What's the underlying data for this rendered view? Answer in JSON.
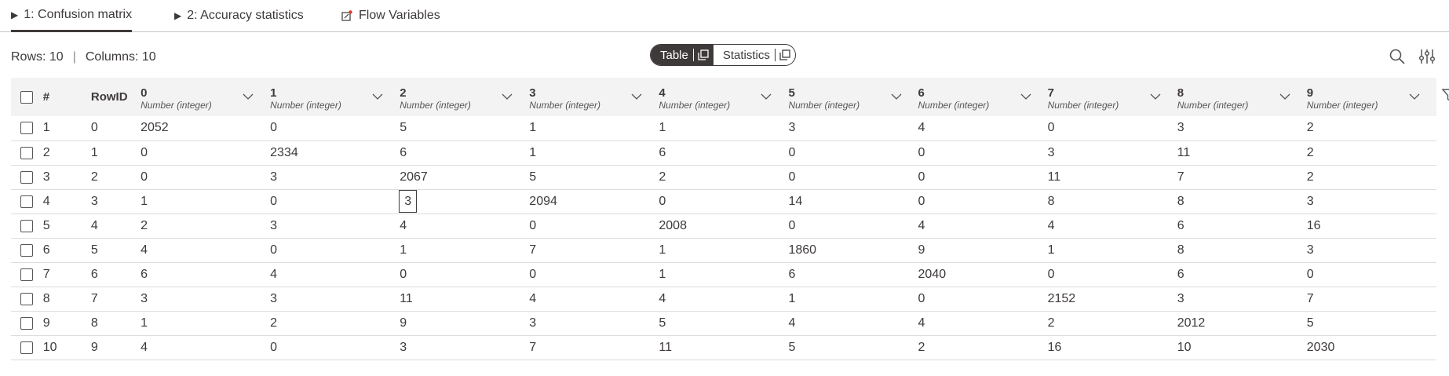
{
  "tabs": [
    {
      "label": "1: Confusion matrix",
      "icon": "play-triangle-icon",
      "active": true
    },
    {
      "label": "2: Accuracy statistics",
      "icon": "play-triangle-icon",
      "active": false
    },
    {
      "label": "Flow Variables",
      "icon": "flow-variable-icon",
      "active": false
    }
  ],
  "counts": {
    "rows": "Rows: 10",
    "separator": "|",
    "columns": "Columns: 10"
  },
  "view_toggle": {
    "table": "Table",
    "statistics": "Statistics",
    "selected": "Table"
  },
  "table": {
    "header": {
      "index": "#",
      "rowid": "RowID"
    },
    "column_type": "Number (integer)",
    "columns": [
      "0",
      "1",
      "2",
      "3",
      "4",
      "5",
      "6",
      "7",
      "8",
      "9"
    ],
    "rows": [
      {
        "idx": "1",
        "rowid": "0",
        "v": [
          "2052",
          "0",
          "5",
          "1",
          "1",
          "3",
          "4",
          "0",
          "3",
          "2"
        ]
      },
      {
        "idx": "2",
        "rowid": "1",
        "v": [
          "0",
          "2334",
          "6",
          "1",
          "6",
          "0",
          "0",
          "3",
          "11",
          "2"
        ]
      },
      {
        "idx": "3",
        "rowid": "2",
        "v": [
          "0",
          "3",
          "2067",
          "5",
          "2",
          "0",
          "0",
          "11",
          "7",
          "2"
        ]
      },
      {
        "idx": "4",
        "rowid": "3",
        "v": [
          "1",
          "0",
          "3",
          "2094",
          "0",
          "14",
          "0",
          "8",
          "8",
          "3"
        ]
      },
      {
        "idx": "5",
        "rowid": "4",
        "v": [
          "2",
          "3",
          "4",
          "0",
          "2008",
          "0",
          "4",
          "4",
          "6",
          "16"
        ]
      },
      {
        "idx": "6",
        "rowid": "5",
        "v": [
          "4",
          "0",
          "1",
          "7",
          "1",
          "1860",
          "9",
          "1",
          "8",
          "3"
        ]
      },
      {
        "idx": "7",
        "rowid": "6",
        "v": [
          "6",
          "4",
          "0",
          "0",
          "1",
          "6",
          "2040",
          "0",
          "6",
          "0"
        ]
      },
      {
        "idx": "8",
        "rowid": "7",
        "v": [
          "3",
          "3",
          "11",
          "4",
          "4",
          "1",
          "0",
          "2152",
          "3",
          "7"
        ]
      },
      {
        "idx": "9",
        "rowid": "8",
        "v": [
          "1",
          "2",
          "9",
          "3",
          "5",
          "4",
          "4",
          "2",
          "2012",
          "5"
        ]
      },
      {
        "idx": "10",
        "rowid": "9",
        "v": [
          "4",
          "0",
          "3",
          "7",
          "11",
          "5",
          "2",
          "16",
          "10",
          "2030"
        ]
      }
    ],
    "selected_cell": {
      "row": 3,
      "col": 2
    }
  },
  "icons": {
    "search": "search-icon",
    "settings": "sliders-icon",
    "filter": "filter-icon",
    "column_menu": "chevron-down-icon"
  }
}
